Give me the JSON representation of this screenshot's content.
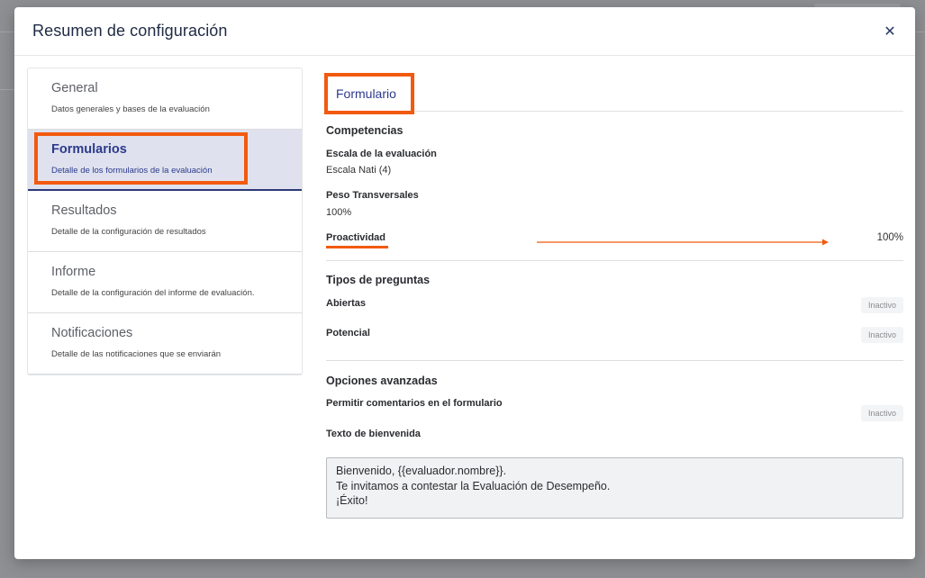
{
  "modal": {
    "title": "Resumen de configuración",
    "close_glyph": "✕"
  },
  "sidebar": {
    "items": [
      {
        "label": "General",
        "description": "Datos generales y bases de la evaluación"
      },
      {
        "label": "Formularios",
        "description": "Detalle de los formularios de la evaluación"
      },
      {
        "label": "Resultados",
        "description": "Detalle de la configuración de resultados"
      },
      {
        "label": "Informe",
        "description": "Detalle de la configuración del informe de evaluación."
      },
      {
        "label": "Notificaciones",
        "description": "Detalle de las notificaciones que se enviarán"
      }
    ],
    "active_index": 1
  },
  "content": {
    "tab_label": "Formulario",
    "competencias": {
      "title": "Competencias",
      "escala_label": "Escala de la evaluación",
      "escala_value": "Escala Nati (4)",
      "peso_label": "Peso Transversales",
      "peso_value": "100%",
      "proactividad_label": "Proactividad",
      "proactividad_value": "100%"
    },
    "tipos": {
      "title": "Tipos de preguntas",
      "abiertas_label": "Abiertas",
      "abiertas_status": "Inactivo",
      "potencial_label": "Potencial",
      "potencial_status": "Inactivo"
    },
    "opciones": {
      "title": "Opciones avanzadas",
      "comentarios_label": "Permitir comentarios en el formulario",
      "comentarios_status": "Inactivo",
      "bienvenida_label": "Texto de bienvenida",
      "bienvenida_lines": [
        "Bienvenido, {{evaluador.nombre}}.",
        "Te invitamos a contestar la Evaluación de Desempeño.",
        "¡Éxito!"
      ]
    }
  },
  "colors": {
    "accent": "#2c3a8c",
    "highlight": "#f25a0f"
  }
}
